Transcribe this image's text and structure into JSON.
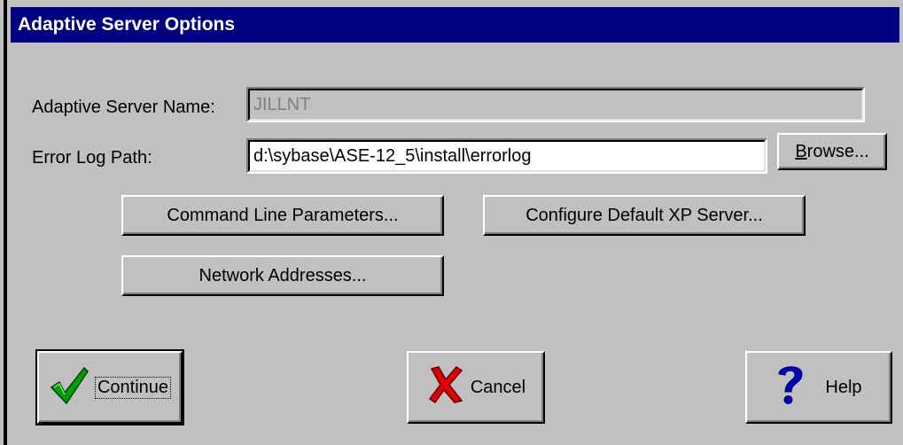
{
  "window": {
    "title": "Adaptive Server Options"
  },
  "fields": {
    "server_name_label": "Adaptive Server Name:",
    "server_name_value": "JILLNT",
    "error_log_label": "Error Log Path:",
    "error_log_value": "d:\\sybase\\ASE-12_5\\install\\errorlog"
  },
  "buttons": {
    "browse_first": "B",
    "browse_rest": "rowse...",
    "command_line": "Command Line Parameters...",
    "configure_xp": "Configure Default XP Server...",
    "network_addresses": "Network Addresses...",
    "continue": "Continue",
    "cancel": "Cancel",
    "help": "Help"
  },
  "icons": {
    "continue": "checkmark-icon",
    "cancel": "x-mark-icon",
    "help": "question-mark-icon"
  },
  "colors": {
    "title_bar": "#000080",
    "dialog_face": "#c0c0c0",
    "check_green": "#00a000",
    "x_red": "#e00000",
    "help_blue": "#0000c0"
  }
}
